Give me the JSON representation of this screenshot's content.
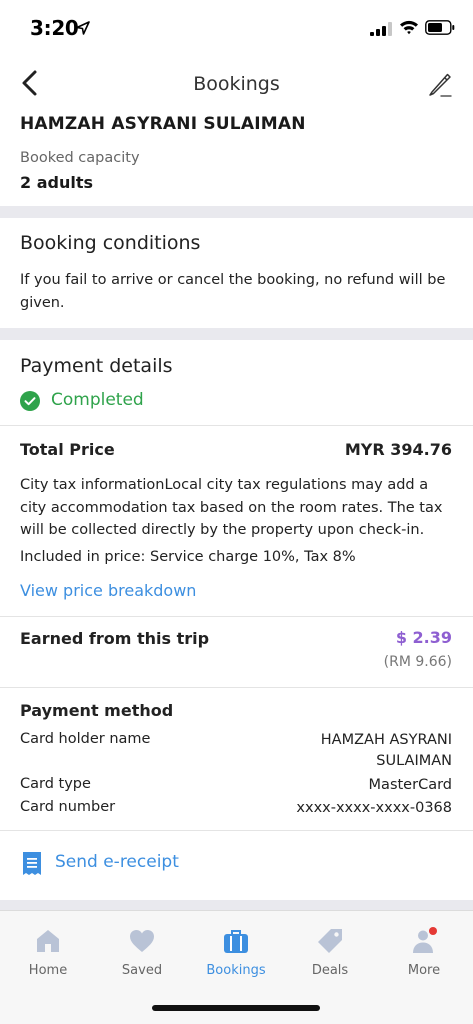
{
  "status_bar": {
    "time": "3:20"
  },
  "header": {
    "title": "Bookings"
  },
  "guest": {
    "name": "HAMZAH ASYRANI SULAIMAN",
    "capacity_label": "Booked capacity",
    "capacity_value": "2 adults"
  },
  "conditions": {
    "title": "Booking conditions",
    "text": "If you fail to arrive or cancel the booking, no refund will be given."
  },
  "payment": {
    "title": "Payment details",
    "status": "Completed",
    "status_color": "#2fa34b",
    "total_label": "Total Price",
    "total_value": "MYR 394.76",
    "tax_info": "City tax informationLocal city tax regulations may add a city accommodation tax based on the room rates. The tax will be collected directly by the property upon check-in.",
    "included": "Included in price: Service charge 10%, Tax 8%",
    "breakdown_link": "View price breakdown"
  },
  "earned": {
    "label": "Earned from this trip",
    "value": "$ 2.39",
    "sub_value": "(RM 9.66)",
    "value_color": "#8e5fd1"
  },
  "payment_method": {
    "title": "Payment method",
    "holder_label": "Card holder name",
    "holder_value_line1": "HAMZAH ASYRANI",
    "holder_value_line2": "SULAIMAN",
    "type_label": "Card type",
    "type_value": "MasterCard",
    "number_label": "Card number",
    "number_value": "xxxx-xxxx-xxxx-0368"
  },
  "receipt": {
    "label": "Send e-receipt",
    "icon": "receipt-icon"
  },
  "tabbar": {
    "items": [
      {
        "label": "Home",
        "icon": "home-icon"
      },
      {
        "label": "Saved",
        "icon": "heart-icon"
      },
      {
        "label": "Bookings",
        "icon": "briefcase-icon",
        "active": true
      },
      {
        "label": "Deals",
        "icon": "tag-icon"
      },
      {
        "label": "More",
        "icon": "person-icon",
        "badge": true
      }
    ],
    "active_color": "#3d8fe0",
    "inactive_color": "#b9c3d6",
    "badge_color": "#e53935"
  }
}
